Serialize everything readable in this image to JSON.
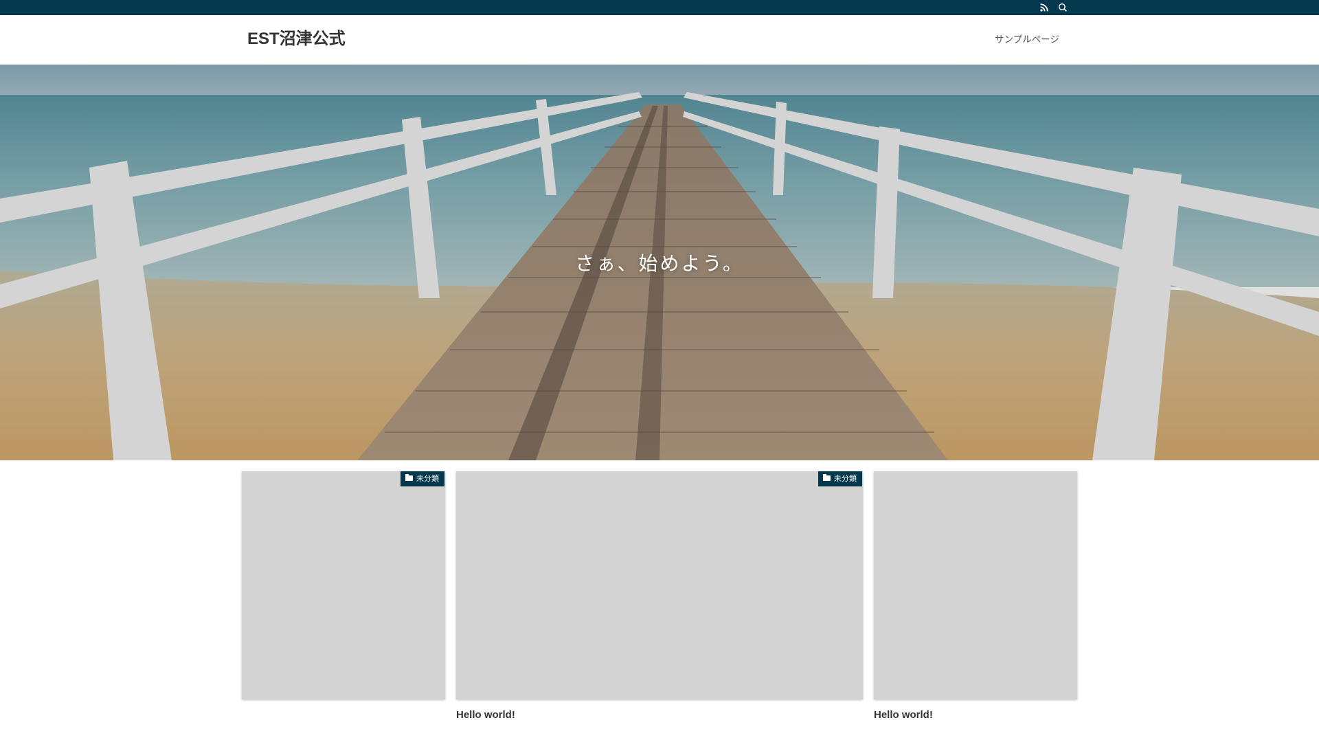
{
  "topbar": {
    "icons": [
      "rss-icon",
      "search-icon"
    ],
    "color": "#04384c"
  },
  "header": {
    "site_title": "EST沼津公式",
    "nav": [
      {
        "label": "サンプルページ"
      }
    ]
  },
  "hero": {
    "tagline": "さぁ、始めよう。"
  },
  "cards": [
    {
      "category": "未分類",
      "title": ""
    },
    {
      "category": "未分類",
      "title": "Hello world!"
    },
    {
      "category": "",
      "title": "Hello world!"
    }
  ],
  "colors": {
    "accent": "#04384c",
    "placeholder": "#d3d3d3"
  }
}
